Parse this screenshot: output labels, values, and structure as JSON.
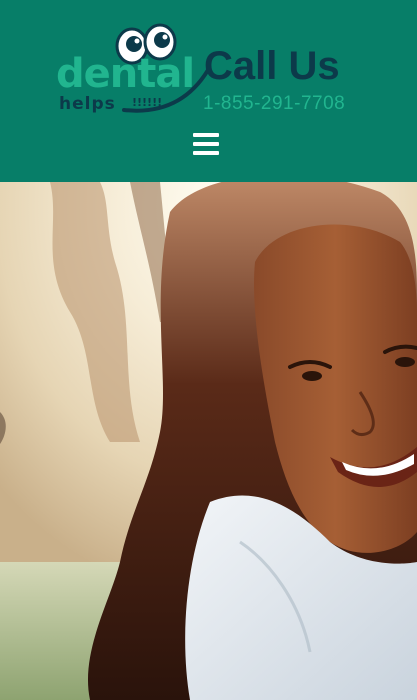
{
  "header": {
    "brand": {
      "word": "dental",
      "sub": "helps",
      "bangs": "!!!!!!",
      "name": "dental helps"
    },
    "cta": {
      "title": "Call Us",
      "phone": "1-855-291-7708"
    },
    "menu_icon": "hamburger-menu-icon"
  },
  "hero": {
    "image": "smiling woman with long dark hair in sunlight"
  },
  "colors": {
    "header_bg": "#077e68",
    "brand_green": "#21b58f",
    "brand_navy": "#0c3a4a"
  }
}
